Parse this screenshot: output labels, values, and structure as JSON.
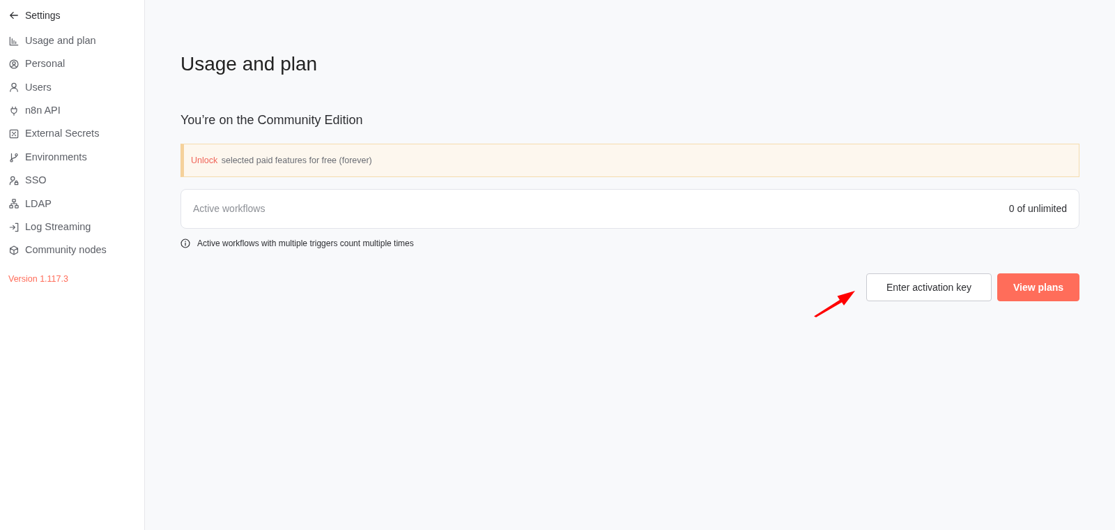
{
  "sidebar": {
    "back_label": "Settings",
    "items": [
      {
        "label": "Usage and plan"
      },
      {
        "label": "Personal"
      },
      {
        "label": "Users"
      },
      {
        "label": "n8n API"
      },
      {
        "label": "External Secrets"
      },
      {
        "label": "Environments"
      },
      {
        "label": "SSO"
      },
      {
        "label": "LDAP"
      },
      {
        "label": "Log Streaming"
      },
      {
        "label": "Community nodes"
      }
    ],
    "version": "Version 1.117.3"
  },
  "page": {
    "title": "Usage and plan",
    "subtitle": "You’re on the Community Edition",
    "banner": {
      "link": "Unlock",
      "text": "selected paid features for free (forever)"
    },
    "usage": {
      "label": "Active workflows",
      "value": "0 of unlimited"
    },
    "note": "Active workflows with multiple triggers count multiple times",
    "buttons": [
      {
        "label": "Enter activation key",
        "kind": "secondary"
      },
      {
        "label": "View plans",
        "kind": "primary"
      }
    ]
  }
}
